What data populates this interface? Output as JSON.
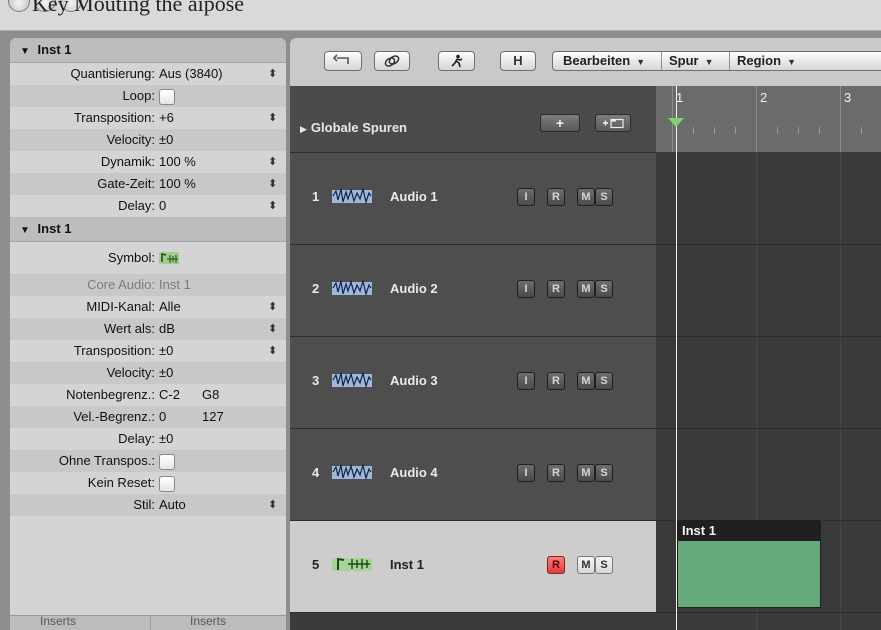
{
  "window": {
    "title": "Key Mouting the aipose"
  },
  "inspector": {
    "region_section": {
      "title": "Inst 1",
      "params": [
        {
          "label": "Quantisierung:",
          "value": "Aus (3840)",
          "stepper": true
        },
        {
          "label": "Loop:",
          "checkbox": true
        },
        {
          "label": "Transposition:",
          "value": "+6",
          "stepper": true
        },
        {
          "label": "Velocity:",
          "value": "±0"
        },
        {
          "label": "Dynamik:",
          "value": "100 %",
          "stepper": true
        },
        {
          "label": "Gate-Zeit:",
          "value": "100 %",
          "stepper": true
        },
        {
          "label": "Delay:",
          "value": "0",
          "stepper": true
        }
      ]
    },
    "track_section": {
      "title": "Inst 1",
      "symbol_label": "Symbol:",
      "params": [
        {
          "label": "Core Audio:",
          "value": "Inst 1",
          "dim": true
        },
        {
          "label": "MIDI-Kanal:",
          "value": "Alle",
          "stepper": true
        },
        {
          "label": "Wert als:",
          "value": "dB",
          "stepper": true
        },
        {
          "label": "Transposition:",
          "value": "±0",
          "stepper": true
        },
        {
          "label": "Velocity:",
          "value": "±0"
        },
        {
          "label": "Notenbegrenz.:",
          "value": "C-2",
          "value2": "G8"
        },
        {
          "label": "Vel.-Begrenz.:",
          "value": "0",
          "value2": "127"
        },
        {
          "label": "Delay:",
          "value": "±0"
        },
        {
          "label": "Ohne Transpos.:",
          "checkbox": true
        },
        {
          "label": "Kein Reset:",
          "checkbox": true
        },
        {
          "label": "Stil:",
          "value": "Auto",
          "stepper": true
        }
      ]
    },
    "inserts": [
      "Inserts",
      "Inserts"
    ]
  },
  "toolbar": {
    "h_label": "H",
    "menus": [
      "Bearbeiten",
      "Spur",
      "Region"
    ]
  },
  "global_tracks": {
    "label": "Globale Spuren",
    "add_label": "+"
  },
  "tracks": [
    {
      "num": "1",
      "name": "Audio 1",
      "type": "audio",
      "buttons": [
        "I",
        "R",
        "M",
        "S"
      ]
    },
    {
      "num": "2",
      "name": "Audio 2",
      "type": "audio",
      "buttons": [
        "I",
        "R",
        "M",
        "S"
      ]
    },
    {
      "num": "3",
      "name": "Audio 3",
      "type": "audio",
      "buttons": [
        "I",
        "R",
        "M",
        "S"
      ]
    },
    {
      "num": "4",
      "name": "Audio 4",
      "type": "audio",
      "buttons": [
        "I",
        "R",
        "M",
        "S"
      ]
    },
    {
      "num": "5",
      "name": "Inst 1",
      "type": "instrument",
      "selected": true,
      "record_armed": true,
      "buttons": [
        "R",
        "M",
        "S"
      ]
    }
  ],
  "ruler": {
    "bars": [
      "1",
      "2",
      "3"
    ]
  },
  "region": {
    "name": "Inst 1",
    "color": "#66a97a"
  },
  "colors": {
    "playhead_marker": "#7fd36c",
    "record_armed": "#e23b3b"
  }
}
